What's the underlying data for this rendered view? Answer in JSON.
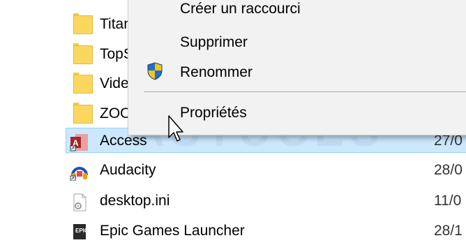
{
  "file_list": {
    "rows": [
      {
        "name": "Titan",
        "type": "folder"
      },
      {
        "name": "TopS",
        "type": "folder"
      },
      {
        "name": "Vide",
        "type": "folder"
      },
      {
        "name": "ZOO",
        "type": "folder"
      },
      {
        "name": "Access",
        "type": "shortcut",
        "date": "27/0",
        "selected": true
      },
      {
        "name": "Audacity",
        "type": "shortcut",
        "date": "28/0"
      },
      {
        "name": "desktop.ini",
        "type": "settings-file",
        "date": "11/0"
      },
      {
        "name": "Epic Games Launcher",
        "type": "shortcut",
        "date": "28/1"
      }
    ]
  },
  "context_menu": {
    "items": [
      {
        "label": "Créer un raccourci",
        "icon": null
      },
      {
        "label": "Supprimer",
        "icon": null
      },
      {
        "label": "Renommer",
        "icon": "uac-shield-icon"
      },
      {
        "label": "Propriétés",
        "icon": null
      }
    ]
  },
  "watermark": "ASTUCES",
  "colors": {
    "selection": "#cce8ff",
    "menu_bg": "#f2f2f2",
    "folder": "#fbd760"
  }
}
